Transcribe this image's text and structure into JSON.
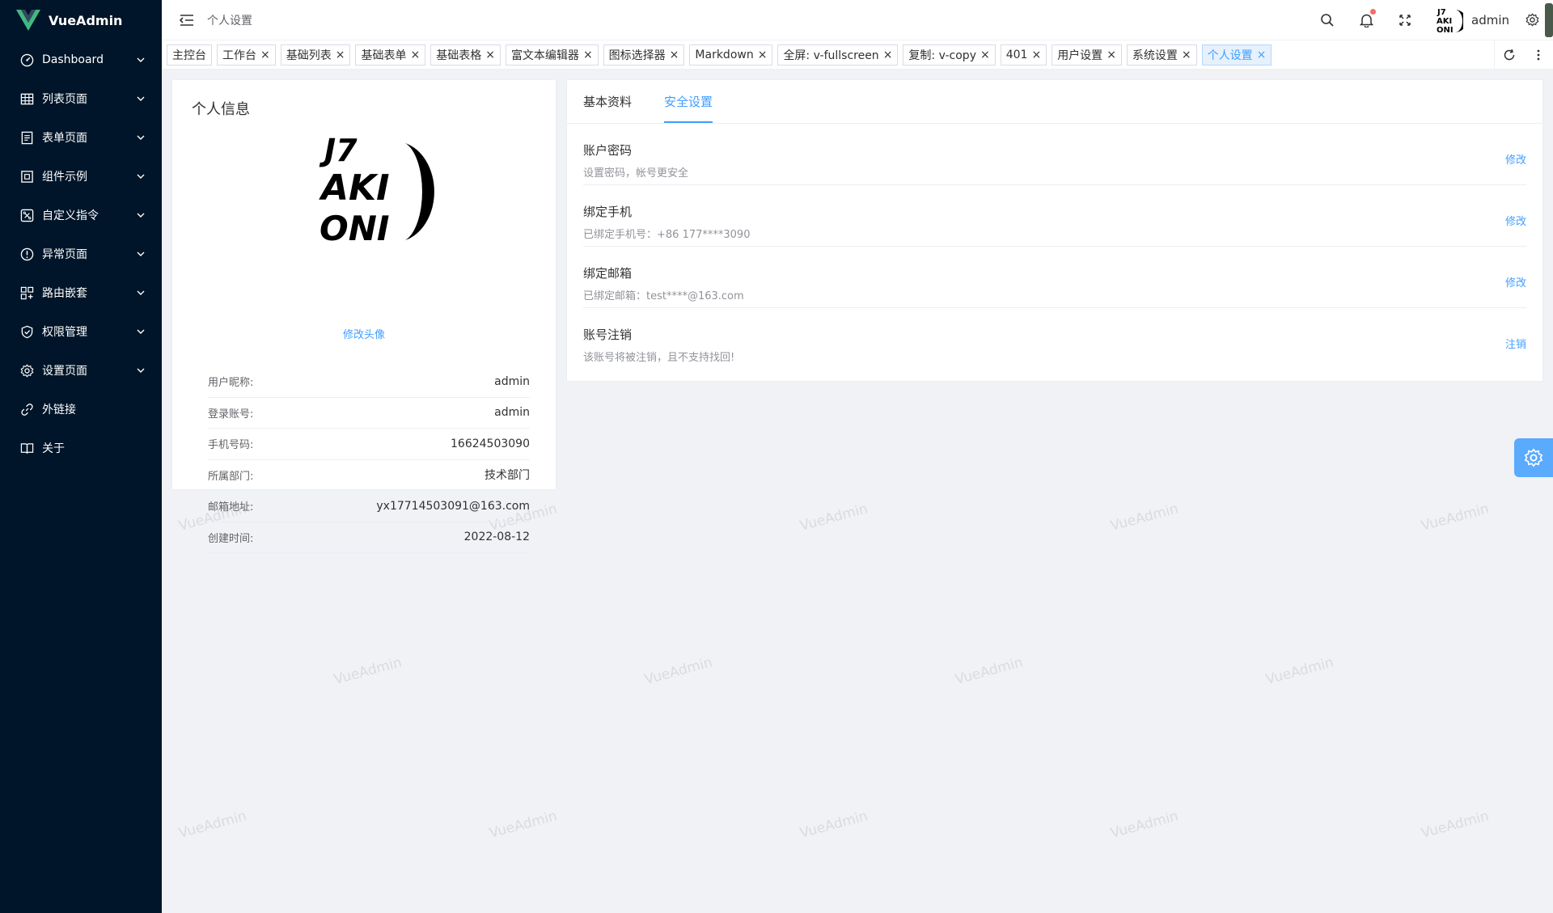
{
  "app": {
    "name": "VueAdmin"
  },
  "sidebar": {
    "items": [
      {
        "label": "Dashboard",
        "icon": "dashboard-icon",
        "has_children": true
      },
      {
        "label": "列表页面",
        "icon": "table-icon",
        "has_children": true
      },
      {
        "label": "表单页面",
        "icon": "form-icon",
        "has_children": true
      },
      {
        "label": "组件示例",
        "icon": "component-icon",
        "has_children": true
      },
      {
        "label": "自定义指令",
        "icon": "command-icon",
        "has_children": true
      },
      {
        "label": "异常页面",
        "icon": "warning-icon",
        "has_children": true
      },
      {
        "label": "路由嵌套",
        "icon": "nested-icon",
        "has_children": true
      },
      {
        "label": "权限管理",
        "icon": "shield-icon",
        "has_children": true
      },
      {
        "label": "设置页面",
        "icon": "gear-icon",
        "has_children": true
      },
      {
        "label": "外链接",
        "icon": "link-icon",
        "has_children": false
      },
      {
        "label": "关于",
        "icon": "book-icon",
        "has_children": false
      }
    ]
  },
  "header": {
    "breadcrumb": "个人设置",
    "username": "admin",
    "notification_dot_color": "#f56c6c"
  },
  "tags": {
    "items": [
      {
        "label": "主控台",
        "closable": false
      },
      {
        "label": "工作台",
        "closable": true
      },
      {
        "label": "基础列表",
        "closable": true
      },
      {
        "label": "基础表单",
        "closable": true
      },
      {
        "label": "基础表格",
        "closable": true
      },
      {
        "label": "富文本编辑器",
        "closable": true
      },
      {
        "label": "图标选择器",
        "closable": true
      },
      {
        "label": "Markdown",
        "closable": true
      },
      {
        "label": "全屏: v-fullscreen",
        "closable": true
      },
      {
        "label": "复制: v-copy",
        "closable": true
      },
      {
        "label": "401",
        "closable": true
      },
      {
        "label": "用户设置",
        "closable": true
      },
      {
        "label": "系统设置",
        "closable": true
      },
      {
        "label": "个人设置",
        "closable": true,
        "active": true
      }
    ],
    "close_glyph": "×"
  },
  "profile": {
    "title": "个人信息",
    "change_avatar": "修改头像",
    "avatar_text": [
      "J7",
      "AKI",
      "ONI"
    ],
    "fields": [
      {
        "key": "用户昵称:",
        "value": "admin"
      },
      {
        "key": "登录账号:",
        "value": "admin"
      },
      {
        "key": "手机号码:",
        "value": "16624503090"
      },
      {
        "key": "所属部门:",
        "value": "技术部门"
      },
      {
        "key": "邮箱地址:",
        "value": "yx17714503091@163.com"
      },
      {
        "key": "创建时间:",
        "value": "2022-08-12"
      }
    ]
  },
  "settings": {
    "tabs": [
      {
        "label": "基本资料",
        "active": false
      },
      {
        "label": "安全设置",
        "active": true
      }
    ],
    "items": [
      {
        "title": "账户密码",
        "desc": "设置密码，帐号更安全",
        "action": "修改"
      },
      {
        "title": "绑定手机",
        "desc": "已绑定手机号：+86 177****3090",
        "action": "修改"
      },
      {
        "title": "绑定邮箱",
        "desc": "已绑定邮箱：test****@163.com",
        "action": "修改"
      },
      {
        "title": "账号注销",
        "desc": "该账号将被注销，且不支持找回!",
        "action": "注销"
      }
    ]
  },
  "watermark": {
    "text": "VueAdmin"
  },
  "colors": {
    "sidebar_bg": "#001529",
    "accent": "#409eff",
    "page_bg": "#f0f2f5",
    "logo_green": "#41b883",
    "logo_dark": "#35495e"
  }
}
